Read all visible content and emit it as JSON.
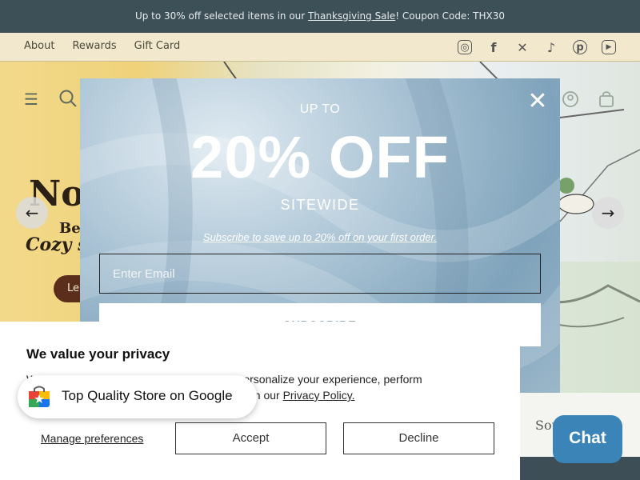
{
  "announcement": {
    "prefix": "Up to 30% off selected items in our ",
    "link": "Thanksgiving Sale",
    "suffix": "! Coupon Code: THX30"
  },
  "subnav": {
    "links": [
      "About",
      "Rewards",
      "Gift Card"
    ],
    "social_icons": [
      "instagram-icon",
      "facebook-icon",
      "x-icon",
      "tiktok-icon",
      "pinterest-icon",
      "youtube-icon"
    ]
  },
  "header_icons": [
    "menu-icon",
    "search-icon",
    "account-icon",
    "cart-icon"
  ],
  "hero": {
    "title": "Now",
    "subtitle_line1": "Be",
    "subtitle_line2": "Cozy s",
    "button_label": "Le"
  },
  "popup": {
    "upto": "UP TO",
    "headline": "20% OFF",
    "sitewide": "SITEWIDE",
    "subscribe_text": "Subscribe to save up to 20% off on your first order.",
    "email_placeholder": "Enter Email",
    "subscribe_button": "SUBSCRIBE",
    "close_icon": "close-icon"
  },
  "privacy": {
    "title": "We value your privacy",
    "text_line1": "We use cookies and other technologies to personalize your experience, perform",
    "text_line2_visible": "e in our ",
    "policy_link": "Privacy Policy.",
    "manage": "Manage preferences",
    "accept": "Accept",
    "decline": "Decline"
  },
  "google_badge": {
    "label": "Top Quality Store on Google"
  },
  "strip_text": "Sou",
  "chat": {
    "label": "Chat"
  },
  "colors": {
    "announce_bg": "#3d4f57",
    "chat_bg": "#3b84b8",
    "popup_blue": "#a7c1d3"
  }
}
